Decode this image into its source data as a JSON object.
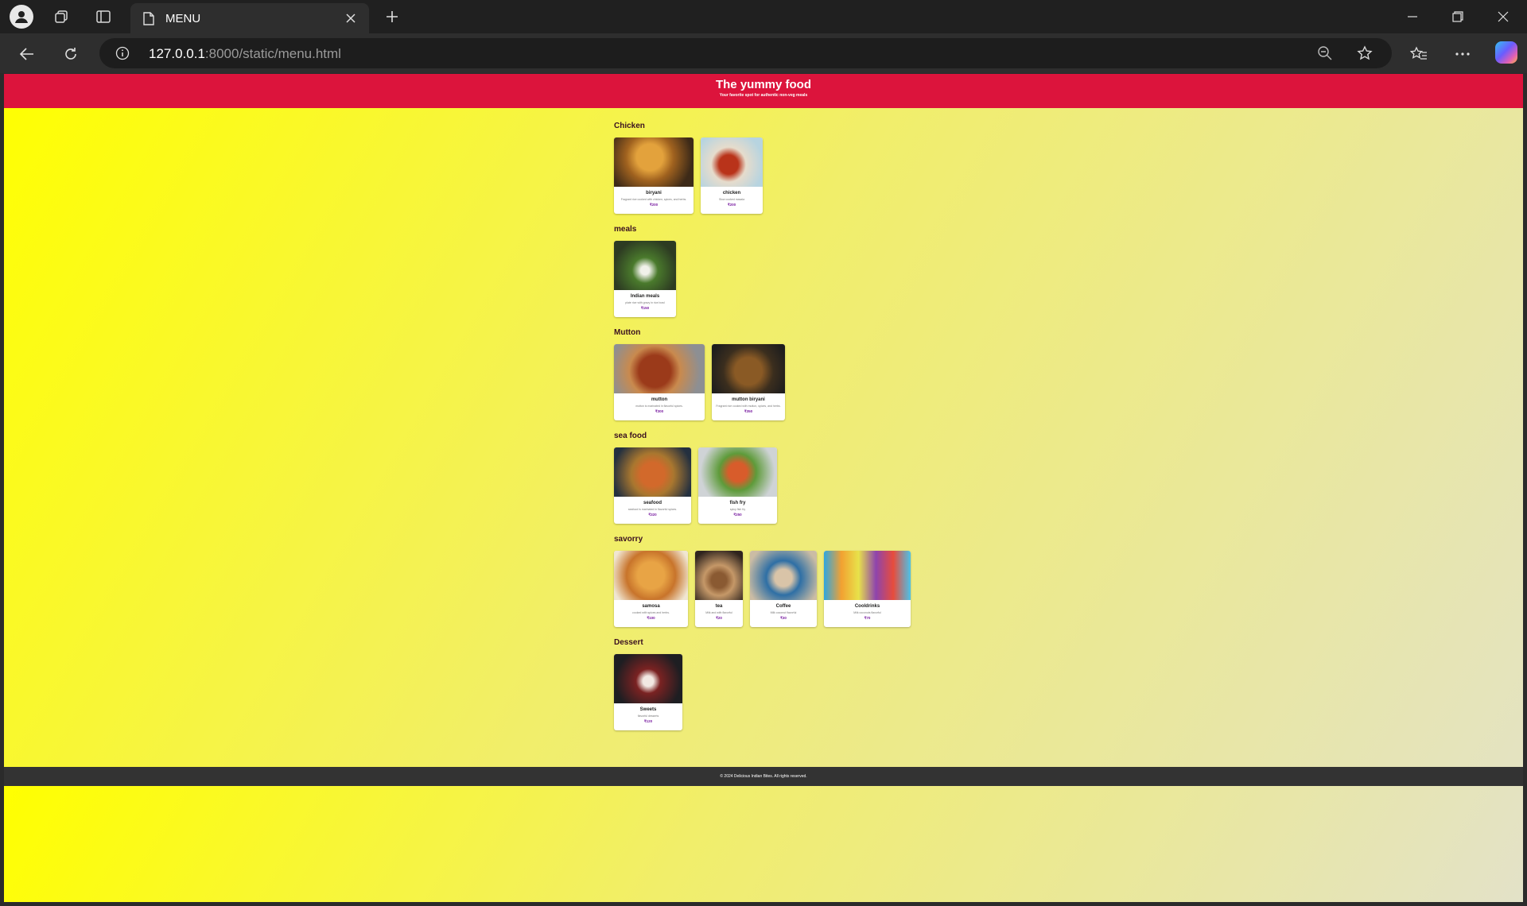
{
  "browser": {
    "tab_title": "MENU",
    "url_host": "127.0.0.1",
    "url_rest": ":8000/static/menu.html"
  },
  "site": {
    "title": "The yummy food",
    "tagline": "Your favorite spot for authentic non-veg meals",
    "footer": "© 2024 Delicious Indian Bites. All rights reserved."
  },
  "categories": [
    {
      "title": "Chicken",
      "items": [
        {
          "name": "biryani",
          "desc": "Fragrant rice cooked with chicken, spices, and herbs.",
          "price": "₹200"
        },
        {
          "name": "chicken",
          "desc": "Slow cooked masala",
          "price": "₹200"
        }
      ]
    },
    {
      "title": "meals",
      "items": [
        {
          "name": "Indian meals",
          "desc": "plate rice with gravy in rice bowl",
          "price": "₹150"
        }
      ]
    },
    {
      "title": "Mutton",
      "items": [
        {
          "name": "mutton",
          "desc": "mutton is marinated in flavorful spices.",
          "price": "₹300"
        },
        {
          "name": "mutton biryani",
          "desc": "Fragrant rice cooked with mutton, spices, and herbs.",
          "price": "₹350"
        }
      ]
    },
    {
      "title": "sea food",
      "items": [
        {
          "name": "seafood",
          "desc": "seafood is marinated in flavorful spices.",
          "price": "₹320"
        },
        {
          "name": "fish fry",
          "desc": "spicy fish fry",
          "price": "₹250"
        }
      ]
    },
    {
      "title": "savorry",
      "items": [
        {
          "name": "samosa",
          "desc": "cooked with spices and herbs.",
          "price": "₹100"
        },
        {
          "name": "tea",
          "desc": "Milk and with flavorful",
          "price": "₹20"
        },
        {
          "name": "Coffee",
          "desc": "Milk coconut flavorful",
          "price": "₹30"
        },
        {
          "name": "Cooldrinks",
          "desc": "Milk coconuts flavorful",
          "price": "₹70"
        }
      ]
    },
    {
      "title": "Dessert",
      "items": [
        {
          "name": "Sweets",
          "desc": "flavorful desserts",
          "price": "₹120"
        }
      ]
    }
  ]
}
